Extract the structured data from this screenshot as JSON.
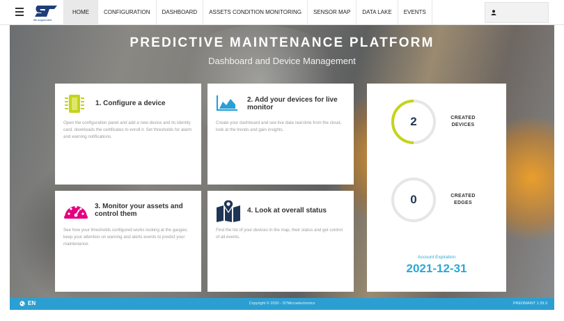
{
  "brand": {
    "logo_text": "ST",
    "tagline": "life.augmented"
  },
  "nav": {
    "items": [
      "HOME",
      "CONFIGURATION",
      "DASHBOARD",
      "ASSETS CONDITION MONITORING",
      "SENSOR MAP",
      "DATA LAKE",
      "EVENTS"
    ],
    "active": "HOME"
  },
  "hero": {
    "title": "PREDICTIVE MAINTENANCE PLATFORM",
    "subtitle": "Dashboard and Device Management"
  },
  "cards": [
    {
      "title": "1. Configure a device",
      "icon": "chip-icon",
      "icon_color": "#c5d31b",
      "text": "Open the configuration panel and add a new device and its identity card, downloads the certificates to enroll it. Set thresholds for alarm and warning notifications."
    },
    {
      "title": "2. Add your devices for live monitor",
      "icon": "area-chart-icon",
      "icon_color": "#2a9fd6",
      "text": "Create your dashboard and see live data real-time from the cloud, look at the trends and gain insights."
    },
    {
      "title": "3. Monitor your assets and control them",
      "icon": "gauge-icon",
      "icon_color": "#e6007e",
      "text": "See how your thresholds configured works looking at the gauges; keep your attention on warning and alerts events to predict your maintenance."
    },
    {
      "title": "4. Look at overall status",
      "icon": "map-pin-icon",
      "icon_color": "#1f3556",
      "text": "Find the list of your devices in the map, their status and get control of all events."
    }
  ],
  "stats": {
    "devices": {
      "value": "2",
      "label_line1": "CREATED",
      "label_line2": "DEVICES",
      "arc_color": "#c5d31b"
    },
    "edges": {
      "value": "0",
      "label_line1": "CREATED",
      "label_line2": "EDGES"
    },
    "expiration_label": "Account Expiration",
    "expiration_date": "2021-12-31"
  },
  "footer": {
    "language": "EN",
    "copyright": "Copyright © 2020 - STMicroelectronics",
    "version": "PREDMAINT 1.39.3"
  }
}
